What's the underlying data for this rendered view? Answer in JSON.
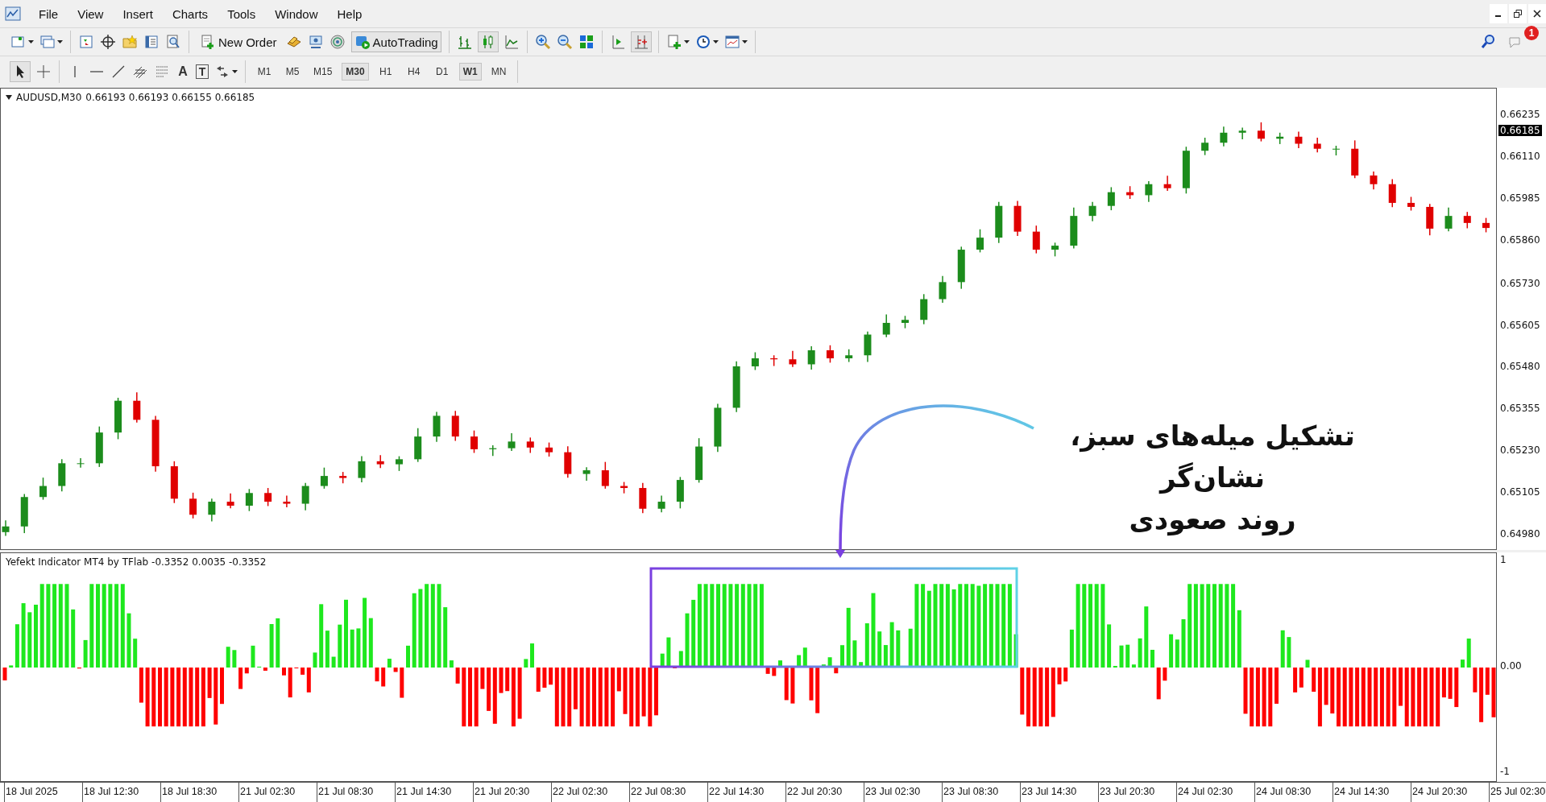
{
  "menu": [
    "File",
    "View",
    "Insert",
    "Charts",
    "Tools",
    "Window",
    "Help"
  ],
  "notifications": {
    "badge": "1"
  },
  "toolbar": {
    "new_order": "New Order",
    "autotrading": {
      "label": "AutoTrading",
      "pressed": true
    }
  },
  "drawing_tools": {
    "text_glyph": "A",
    "label_glyph": "T"
  },
  "timeframes": [
    {
      "label": "M1",
      "selected": false
    },
    {
      "label": "M5",
      "selected": false
    },
    {
      "label": "M15",
      "selected": false
    },
    {
      "label": "M30",
      "selected": true
    },
    {
      "label": "H1",
      "selected": false
    },
    {
      "label": "H4",
      "selected": false
    },
    {
      "label": "D1",
      "selected": false
    },
    {
      "label": "W1",
      "selected": true
    },
    {
      "label": "MN",
      "selected": false
    }
  ],
  "chart": {
    "symbol": "AUDUSD,M30",
    "ohlc": "0.66193 0.66193 0.66155 0.66185",
    "current_price": "0.66185",
    "chart_data": {
      "type": "candlestick",
      "ylim": [
        0.64939,
        0.66317
      ],
      "yticks": [
        {
          "value": 0.66235,
          "label": "0.66235"
        },
        {
          "value": 0.6611,
          "label": "0.66110"
        },
        {
          "value": 0.65985,
          "label": "0.65985"
        },
        {
          "value": 0.6586,
          "label": "0.65860"
        },
        {
          "value": 0.6573,
          "label": "0.65730"
        },
        {
          "value": 0.65605,
          "label": "0.65605"
        },
        {
          "value": 0.6548,
          "label": "0.65480"
        },
        {
          "value": 0.65355,
          "label": "0.65355"
        },
        {
          "value": 0.6523,
          "label": "0.65230"
        },
        {
          "value": 0.65105,
          "label": "0.65105"
        },
        {
          "value": 0.6498,
          "label": "0.64980"
        }
      ],
      "categories": [
        null,
        null,
        null,
        null,
        null,
        null,
        null,
        null,
        null,
        null,
        null,
        null,
        null,
        null,
        null,
        null,
        null,
        null,
        null,
        null,
        null,
        null,
        null,
        null,
        null,
        null,
        null,
        null,
        null,
        null,
        null,
        null,
        null,
        null,
        null,
        null,
        null,
        null,
        null,
        null,
        null,
        null,
        null,
        null,
        null,
        null,
        null,
        null,
        null,
        null,
        null,
        null,
        null,
        null,
        null,
        null,
        null,
        null,
        null,
        null,
        null,
        null,
        null,
        null,
        null,
        null,
        null,
        null,
        null,
        null,
        null,
        null,
        null,
        null,
        null,
        null,
        null,
        null,
        null,
        null
      ],
      "ohlc": [
        [
          0.6499,
          0.65025,
          0.64979,
          0.65007
        ],
        [
          0.65007,
          0.65104,
          0.64987,
          0.65095
        ],
        [
          0.65095,
          0.65153,
          0.65087,
          0.65128
        ],
        [
          0.65128,
          0.65208,
          0.65112,
          0.65196
        ],
        [
          0.65196,
          0.65211,
          0.65183,
          0.65196
        ],
        [
          0.65196,
          0.65306,
          0.65185,
          0.65288
        ],
        [
          0.65288,
          0.65392,
          0.65268,
          0.65383
        ],
        [
          0.65383,
          0.65408,
          0.65318,
          0.65326
        ],
        [
          0.65326,
          0.65338,
          0.65171,
          0.65187
        ],
        [
          0.65187,
          0.65202,
          0.65077,
          0.6509
        ],
        [
          0.6509,
          0.65108,
          0.65031,
          0.65042
        ],
        [
          0.65042,
          0.6509,
          0.65022,
          0.65081
        ],
        [
          0.65081,
          0.65106,
          0.65061,
          0.65069
        ],
        [
          0.65069,
          0.65119,
          0.65053,
          0.65107
        ],
        [
          0.65107,
          0.65122,
          0.65068,
          0.65081
        ],
        [
          0.65081,
          0.65099,
          0.65064,
          0.65075
        ],
        [
          0.65075,
          0.65137,
          0.65055,
          0.65128
        ],
        [
          0.65128,
          0.65183,
          0.6512,
          0.65158
        ],
        [
          0.65158,
          0.6517,
          0.65136,
          0.65152
        ],
        [
          0.65152,
          0.65217,
          0.65139,
          0.65202
        ],
        [
          0.65202,
          0.6522,
          0.65182,
          0.65193
        ],
        [
          0.65193,
          0.65217,
          0.65173,
          0.65208
        ],
        [
          0.65208,
          0.65301,
          0.652,
          0.65276
        ],
        [
          0.65276,
          0.6535,
          0.6526,
          0.65338
        ],
        [
          0.65338,
          0.65353,
          0.65263,
          0.65276
        ],
        [
          0.65276,
          0.65294,
          0.65227,
          0.65238
        ],
        [
          0.65238,
          0.6525,
          0.65218,
          0.65241
        ],
        [
          0.65241,
          0.65286,
          0.65233,
          0.65261
        ],
        [
          0.65261,
          0.65273,
          0.65227,
          0.65243
        ],
        [
          0.65243,
          0.65258,
          0.65216,
          0.65229
        ],
        [
          0.65229,
          0.65247,
          0.65153,
          0.65164
        ],
        [
          0.65164,
          0.65184,
          0.65144,
          0.65175
        ],
        [
          0.65175,
          0.652,
          0.6512,
          0.65128
        ],
        [
          0.65128,
          0.6514,
          0.65106,
          0.65122
        ],
        [
          0.65122,
          0.65137,
          0.65047,
          0.6506
        ],
        [
          0.6506,
          0.65099,
          0.65049,
          0.65081
        ],
        [
          0.65081,
          0.65155,
          0.65061,
          0.65146
        ],
        [
          0.65146,
          0.65271,
          0.65138,
          0.65246
        ],
        [
          0.65246,
          0.65374,
          0.6523,
          0.65362
        ],
        [
          0.65362,
          0.65501,
          0.65349,
          0.65486
        ],
        [
          0.65486,
          0.65528,
          0.65475,
          0.6551
        ],
        [
          0.6551,
          0.65519,
          0.65487,
          0.65507
        ],
        [
          0.65507,
          0.65532,
          0.65484,
          0.65492
        ],
        [
          0.65492,
          0.65546,
          0.65476,
          0.65534
        ],
        [
          0.65534,
          0.65549,
          0.65497,
          0.6551
        ],
        [
          0.6551,
          0.65537,
          0.65499,
          0.65519
        ],
        [
          0.65519,
          0.6559,
          0.65499,
          0.65581
        ],
        [
          0.65581,
          0.65641,
          0.65573,
          0.65616
        ],
        [
          0.65616,
          0.65637,
          0.656,
          0.65625
        ],
        [
          0.65625,
          0.65702,
          0.65612,
          0.65687
        ],
        [
          0.65687,
          0.65756,
          0.65676,
          0.65738
        ],
        [
          0.65738,
          0.65844,
          0.65718,
          0.65835
        ],
        [
          0.65835,
          0.65896,
          0.65827,
          0.65871
        ],
        [
          0.65871,
          0.65978,
          0.65855,
          0.65966
        ],
        [
          0.65966,
          0.65981,
          0.65876,
          0.65889
        ],
        [
          0.65889,
          0.65907,
          0.65824,
          0.65835
        ],
        [
          0.65835,
          0.65856,
          0.65815,
          0.65847
        ],
        [
          0.65847,
          0.65961,
          0.65839,
          0.65936
        ],
        [
          0.65936,
          0.65978,
          0.6592,
          0.65966
        ],
        [
          0.65966,
          0.66022,
          0.65953,
          0.66007
        ],
        [
          0.66007,
          0.66025,
          0.65987,
          0.65998
        ],
        [
          0.65998,
          0.6604,
          0.65978,
          0.66031
        ],
        [
          0.66031,
          0.66056,
          0.66011,
          0.66019
        ],
        [
          0.66019,
          0.66143,
          0.66003,
          0.66131
        ],
        [
          0.66131,
          0.6617,
          0.66118,
          0.66155
        ],
        [
          0.66155,
          0.66203,
          0.66144,
          0.66185
        ],
        [
          0.66185,
          0.662,
          0.66165,
          0.66191
        ],
        [
          0.66191,
          0.66216,
          0.66159,
          0.66167
        ],
        [
          0.66167,
          0.66185,
          0.66151,
          0.66173
        ],
        [
          0.66173,
          0.66188,
          0.66139,
          0.66152
        ],
        [
          0.66152,
          0.6617,
          0.66126,
          0.66137
        ],
        [
          0.66137,
          0.66146,
          0.66117,
          0.66137
        ],
        [
          0.66137,
          0.66162,
          0.66049,
          0.66057
        ],
        [
          0.66057,
          0.66069,
          0.66015,
          0.66031
        ],
        [
          0.66031,
          0.66046,
          0.65962,
          0.65975
        ],
        [
          0.65975,
          0.65993,
          0.65952,
          0.65963
        ],
        [
          0.65963,
          0.65972,
          0.65878,
          0.65898
        ],
        [
          0.65898,
          0.65961,
          0.6589,
          0.65936
        ],
        [
          0.65936,
          0.65948,
          0.65899,
          0.65915
        ],
        [
          0.65915,
          0.6593,
          0.65887,
          0.659
        ]
      ]
    }
  },
  "indicator": {
    "title": "Yefekt Indicator MT4 by TFlab -0.3352 0.0035 -0.3352",
    "ticks": [
      "1",
      "0.00",
      "-1"
    ]
  },
  "time_axis": [
    "18 Jul 2025",
    "18 Jul 12:30",
    "18 Jul 18:30",
    "21 Jul 02:30",
    "21 Jul 08:30",
    "21 Jul 14:30",
    "21 Jul 20:30",
    "22 Jul 02:30",
    "22 Jul 08:30",
    "22 Jul 14:30",
    "22 Jul 20:30",
    "23 Jul 02:30",
    "23 Jul 08:30",
    "23 Jul 14:30",
    "23 Jul 20:30",
    "24 Jul 02:30",
    "24 Jul 08:30",
    "24 Jul 14:30",
    "24 Jul 20:30",
    "25 Jul 02:30"
  ],
  "annotation": {
    "text": "تشکیل میله‌های سبز، نشان‌گر\nروند صعودی"
  }
}
